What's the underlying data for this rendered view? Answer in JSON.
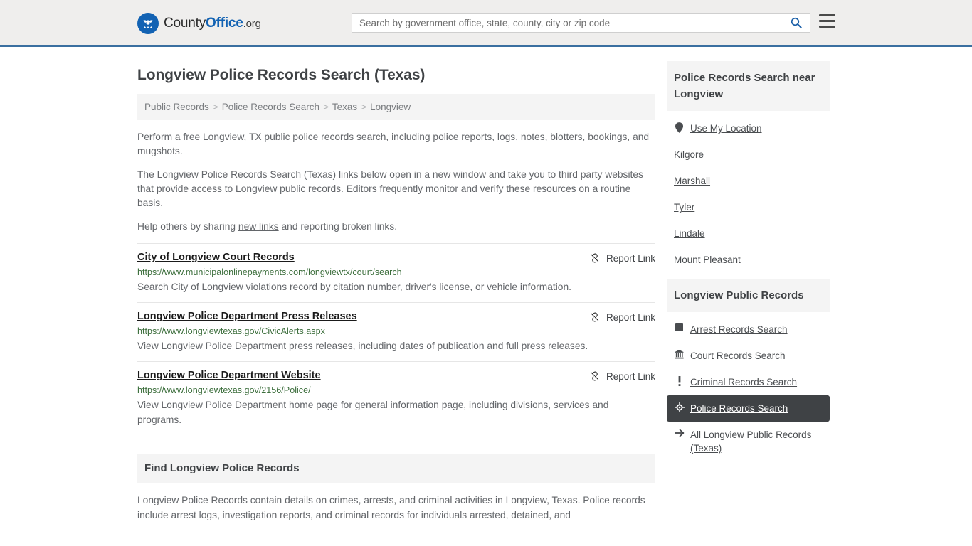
{
  "header": {
    "logo": {
      "name": "CountyOffice.org",
      "part1": "County",
      "part2": "Office",
      "part3": ".org",
      "icon": "eagle-emblem-icon",
      "color": "#1262b3"
    },
    "search": {
      "placeholder": "Search by government office, state, county, city or zip code",
      "value": "",
      "icon": "search-icon",
      "icon_color": "#1a5fa8"
    },
    "menu": {
      "icon": "hamburger-menu-icon",
      "label": "Menu"
    },
    "accent_border_color": "#3a6fa0"
  },
  "page": {
    "title": "Longview Police Records Search (Texas)"
  },
  "breadcrumb": {
    "items": [
      {
        "label": "Public Records"
      },
      {
        "label": "Police Records Search"
      },
      {
        "label": "Texas"
      },
      {
        "label": "Longview"
      }
    ],
    "separator": ">"
  },
  "intro": {
    "p1": "Perform a free Longview, TX public police records search, including police reports, logs, notes, blotters, bookings, and mugshots.",
    "p2": "The Longview Police Records Search (Texas) links below open in a new window and take you to third party websites that provide access to Longview public records. Editors frequently monitor and verify these resources on a routine basis.",
    "p3_before": "Help others by sharing ",
    "p3_link": "new links",
    "p3_after": " and reporting broken links."
  },
  "results": {
    "report_label": "Report Link",
    "report_icon": "broken-link-icon",
    "items": [
      {
        "title": "City of Longview Court Records",
        "url": "https://www.municipalonlinepayments.com/longviewtx/court/search",
        "description": "Search City of Longview violations record by citation number, driver's license, or vehicle information."
      },
      {
        "title": "Longview Police Department Press Releases",
        "url": "https://www.longviewtexas.gov/CivicAlerts.aspx",
        "description": "View Longview Police Department press releases, including dates of publication and full press releases."
      },
      {
        "title": "Longview Police Department Website",
        "url": "https://www.longviewtexas.gov/2156/Police/",
        "description": "View Longview Police Department home page for general information page, including divisions, services and programs."
      }
    ]
  },
  "find_section": {
    "heading": "Find Longview Police Records",
    "body": "Longview Police Records contain details on crimes, arrests, and criminal activities in Longview, Texas. Police records include arrest logs, investigation reports, and criminal records for individuals arrested, detained, and"
  },
  "sidebar": {
    "nearby": {
      "heading": "Police Records Search near Longview",
      "items": [
        {
          "label": "Use My Location",
          "icon": "map-pin-icon",
          "has_icon": true
        },
        {
          "label": "Kilgore",
          "icon": "",
          "has_icon": false
        },
        {
          "label": "Marshall",
          "icon": "",
          "has_icon": false
        },
        {
          "label": "Tyler",
          "icon": "",
          "has_icon": false
        },
        {
          "label": "Lindale",
          "icon": "",
          "has_icon": false
        },
        {
          "label": "Mount Pleasant",
          "icon": "",
          "has_icon": false
        }
      ]
    },
    "public_records": {
      "heading": "Longview Public Records",
      "items": [
        {
          "label": "Arrest Records Search",
          "icon": "square-icon",
          "active": false
        },
        {
          "label": "Court Records Search",
          "icon": "courthouse-icon",
          "active": false
        },
        {
          "label": "Criminal Records Search",
          "icon": "exclamation-icon",
          "active": false
        },
        {
          "label": "Police Records Search",
          "icon": "badge-target-icon",
          "active": true
        },
        {
          "label": "All Longview Public Records (Texas)",
          "icon": "arrow-right-icon",
          "active": false
        }
      ],
      "active_bg_color": "#3f4245"
    }
  }
}
